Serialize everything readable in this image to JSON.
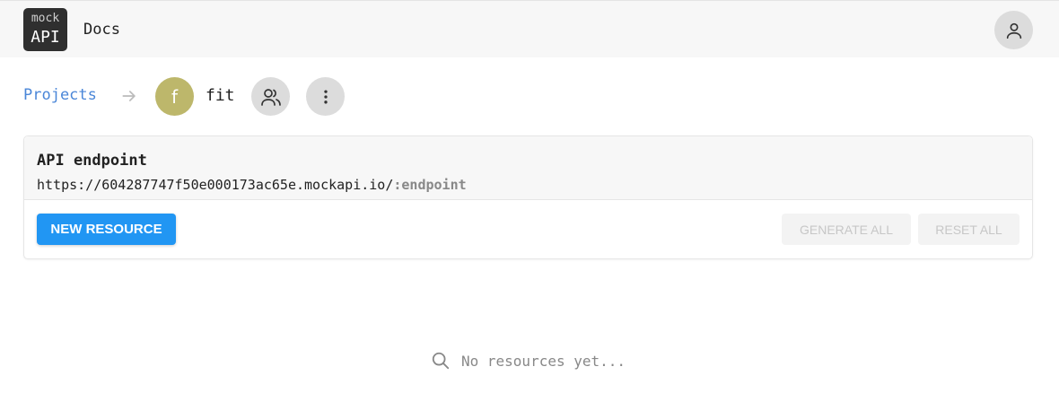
{
  "header": {
    "logo_top": "mock",
    "logo_bottom": "API",
    "docs_label": "Docs",
    "user_icon": "user-icon"
  },
  "breadcrumb": {
    "projects_label": "Projects",
    "arrow_icon": "arrow-right-icon",
    "project_initial": "f",
    "project_name": "fit",
    "project_color": "#bdb76b",
    "members_icon": "users-icon",
    "more_icon": "more-vertical-icon"
  },
  "card": {
    "title": "API endpoint",
    "url_base": "https://604287747f50e000173ac65e.mockapi.io/",
    "url_suffix": ":endpoint",
    "new_resource_label": "NEW RESOURCE",
    "generate_all_label": "GENERATE ALL",
    "reset_all_label": "RESET ALL",
    "accent": "#2196f3"
  },
  "empty_state": {
    "icon": "search-icon",
    "text": "No resources yet..."
  }
}
